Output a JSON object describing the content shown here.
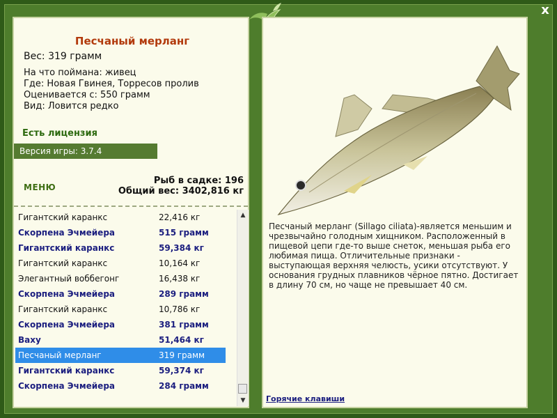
{
  "window": {
    "close_label": "x"
  },
  "fish": {
    "title": "Песчаный мерланг",
    "weight": "Вес: 319 грамм",
    "caught_on": "На что поймана: живец",
    "location": "Где: Новая Гвинея, Торресов пролив",
    "valued_from": "Оценивается с: 550 грамм",
    "rarity": "Вид: Ловится редко",
    "description": "Песчаный мерланг (Sillago ciliata)-является меньшим и чрезвычайно голодным хищником. Расположенный в пищевой цепи где-то выше снеток, меньшая рыба его любимая пища. Отличительные признаки - выступающая верхняя челюсть, усики отсутствуют. У основания грудных плавников чёрное пятно. Достигает в длину 70 см, но чаще не превышает 40 см."
  },
  "license": "Есть лицензия",
  "version": "Версия игры: 3.7.4",
  "menu_label": "МЕНЮ",
  "stats": {
    "fish_count": "Рыб в садке: 196",
    "total_weight": "Общий вес: 3402,816 кг"
  },
  "catch_list": [
    {
      "name": "Гигантский каранкс",
      "weight": "22,416 кг",
      "bold": false,
      "selected": false
    },
    {
      "name": "Скорпена Эчмейера",
      "weight": "515 грамм",
      "bold": true,
      "selected": false
    },
    {
      "name": "Гигантский каранкс",
      "weight": "59,384 кг",
      "bold": true,
      "selected": false
    },
    {
      "name": "Гигантский каранкс",
      "weight": "10,164 кг",
      "bold": false,
      "selected": false
    },
    {
      "name": "Элегантный воббегонг",
      "weight": "16,438 кг",
      "bold": false,
      "selected": false
    },
    {
      "name": "Скорпена Эчмейера",
      "weight": "289 грамм",
      "bold": true,
      "selected": false
    },
    {
      "name": "Гигантский каранкс",
      "weight": "10,786 кг",
      "bold": false,
      "selected": false
    },
    {
      "name": "Скорпена Эчмейера",
      "weight": "381 грамм",
      "bold": true,
      "selected": false
    },
    {
      "name": "Ваху",
      "weight": "51,464 кг",
      "bold": true,
      "selected": false
    },
    {
      "name": "Песчаный мерланг",
      "weight": "319 грамм",
      "bold": false,
      "selected": true
    },
    {
      "name": "Гигантский каранкс",
      "weight": "59,374 кг",
      "bold": true,
      "selected": false
    },
    {
      "name": "Скорпена Эчмейера",
      "weight": "284 грамм",
      "bold": true,
      "selected": false
    }
  ],
  "hotkeys_label": "Горячие клавиши",
  "icons": {
    "close": "close-icon",
    "logo": "dolphin-logo-icon",
    "scroll_up": "arrow-up-icon",
    "scroll_down": "arrow-down-icon"
  },
  "colors": {
    "frame": "#4e7d2c",
    "title": "#b23a0c",
    "selection": "#2f8de8",
    "bold_text": "#1b1e7f"
  }
}
